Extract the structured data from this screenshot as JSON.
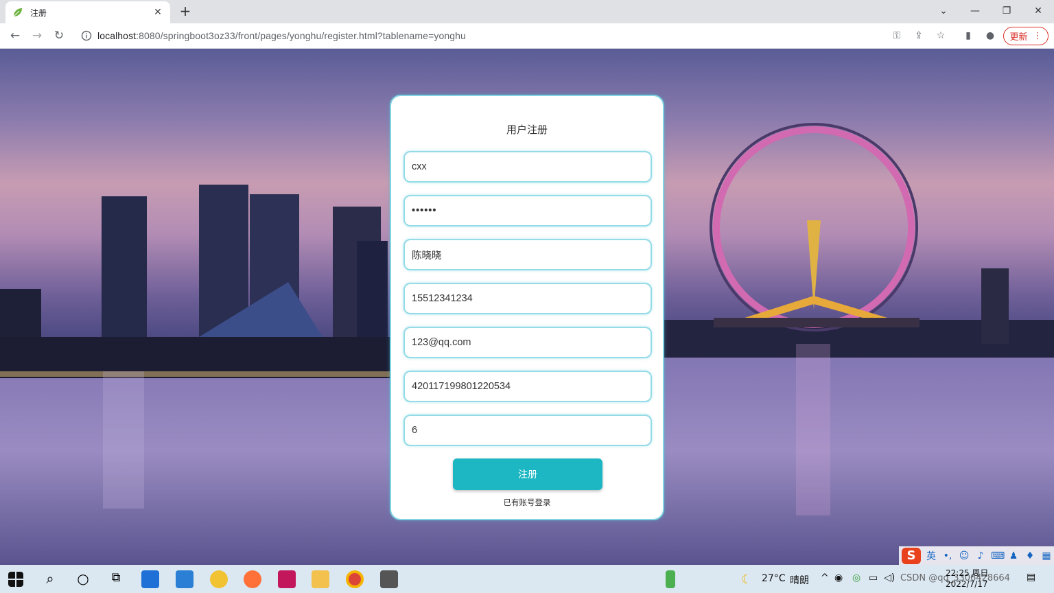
{
  "browser": {
    "tab_title": "注册",
    "tab_close": "✕",
    "new_tab": "+",
    "url_host": "localhost",
    "url_rest": ":8080/springboot3oz33/front/pages/yonghu/register.html?tablename=yonghu",
    "update_label": "更新"
  },
  "form": {
    "title": "用户注册",
    "fields": [
      {
        "name": "account",
        "value": "cxx"
      },
      {
        "name": "password",
        "value": "••••••"
      },
      {
        "name": "name",
        "value": "陈晓晓"
      },
      {
        "name": "phone",
        "value": "15512341234"
      },
      {
        "name": "email",
        "value": "123@qq.com"
      },
      {
        "name": "id-card",
        "value": "420117199801220534"
      },
      {
        "name": "age",
        "value": "6"
      }
    ],
    "submit_label": "注册",
    "login_link": "已有账号登录"
  },
  "taskbar": {
    "weather_temp": "27°C",
    "weather_text": "晴朗",
    "time": "22:25 周日",
    "date": "2022/7/17",
    "ime_lang": "英",
    "watermark": "CSDN @qq_3306428664"
  },
  "colors": {
    "accent": "#1cb7c3",
    "card_border": "#7fd3e0",
    "update_red": "#d93025"
  }
}
